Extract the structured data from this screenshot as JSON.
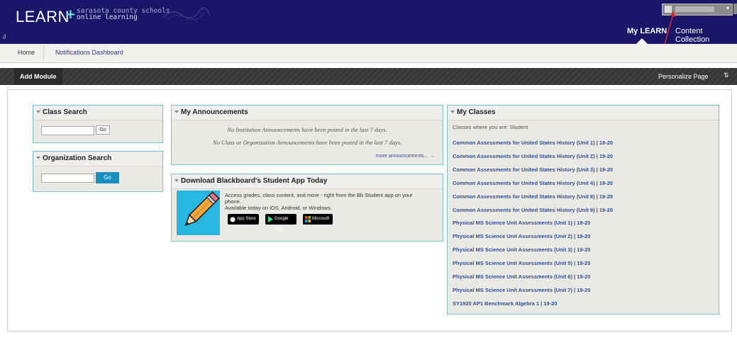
{
  "header": {
    "logo_main": "LEARN",
    "logo_plus": "+",
    "logo_sub_line1": "sarasota county schools",
    "logo_sub_line2": "online learning",
    "tabs": [
      {
        "label": "My LEARN",
        "active": true
      },
      {
        "label": "Content Collection",
        "active": false
      }
    ]
  },
  "breadcrumbs": {
    "home": "Home",
    "notifications": "Notifications Dashboard"
  },
  "module_bar": {
    "add_module": "Add Module",
    "personalize": "Personalize Page",
    "sort_icon": "⇅"
  },
  "class_search": {
    "title": "Class Search",
    "go": "Go"
  },
  "org_search": {
    "title": "Organization Search",
    "go": "Go"
  },
  "announcements": {
    "title": "My Announcements",
    "line1": "No Institution Announcements have been posted in the last 7 days.",
    "line2": "No Class or Organization Announcements have been posted in the last 7 days.",
    "more": "more announcements... →"
  },
  "app_module": {
    "title": "Download Blackboard's Student App Today",
    "line1": "Access grades, class content, and more - right from the Bb Student app on your",
    "line2": "phone.",
    "line3": "Available today on iOS, Android, or Windows.",
    "badges": [
      "App Store",
      "Google Play",
      "Microsoft"
    ]
  },
  "my_classes": {
    "title": "My Classes",
    "subtitle": "Classes where you are: Student",
    "items": [
      "Common Assessments for United States History (Unit 1) | 19-20",
      "Common Assessments for United States History (Unit 2) | 19-20",
      "Common Assessments for United States History (Unit 3) | 19-20",
      "Common Assessments for United States History (Unit 4) | 19-20",
      "Common Assessments for United States History (Unit 8) | 19-20",
      "Common Assessments for United States History (Unit 9) | 19-20",
      "Physical MS Science Unit Assessments (Unit 1) | 19-20",
      "Physical MS Science Unit Assessments (Unit 2) | 19-20",
      "Physical MS Science Unit Assessments (Unit 3) | 19-20",
      "Physical MS Science Unit Assessments (Unit 5) | 19-20",
      "Physical MS Science Unit Assessments (Unit 6) | 19-20",
      "Physical MS Science Unit Assessments (Unit 7) | 19-20",
      "SY1920 AP1 Benchmark Algebra 1 | 19-20"
    ]
  },
  "colors": {
    "header_bg": "#1a1668",
    "module_border": "#74c7cf",
    "link": "#2f4f9a",
    "go_button": "#1b8fbf",
    "app_icon_bg": "#27b7e0"
  }
}
